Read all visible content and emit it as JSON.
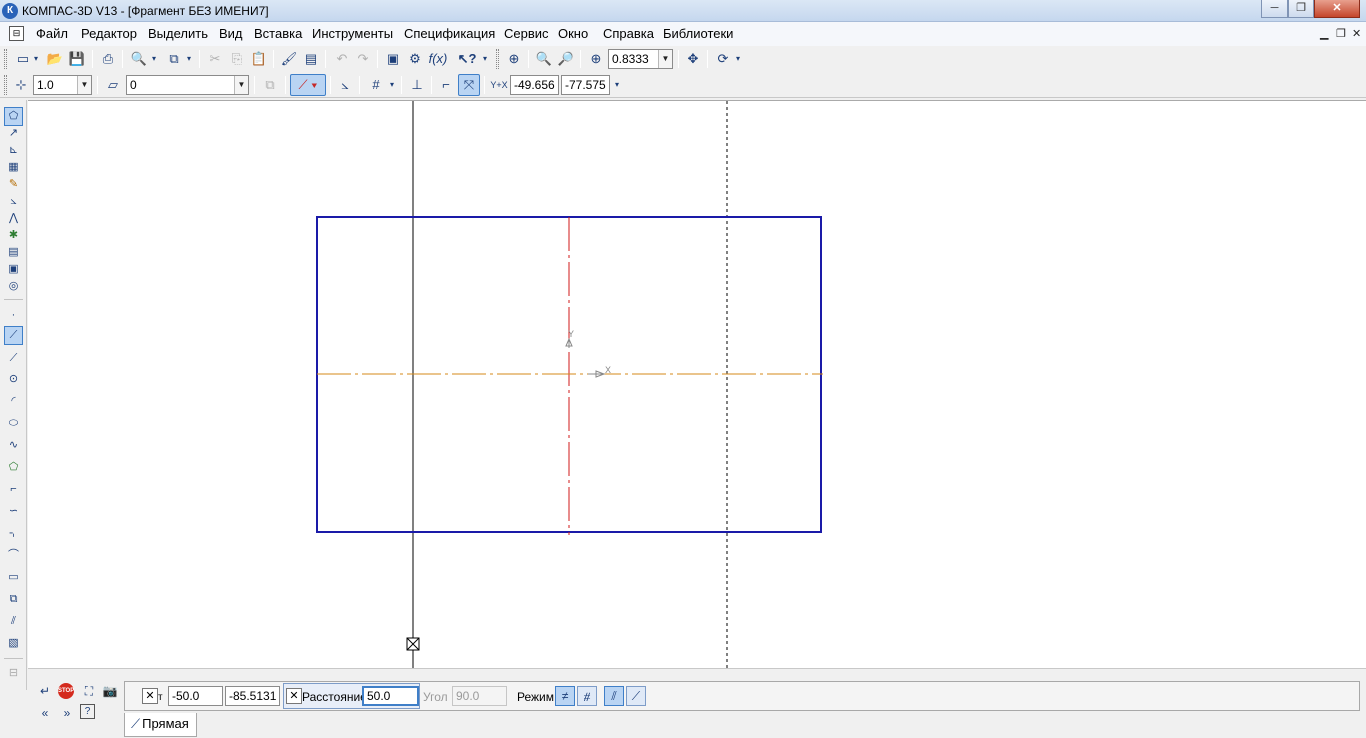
{
  "window": {
    "title": "КОМПАС-3D V13 - [Фрагмент БЕЗ ИМЕНИ7]",
    "logo_letter": "К",
    "minimize": "─",
    "maximize": "❐",
    "close": "✕"
  },
  "menu": {
    "items": [
      "Файл",
      "Редактор",
      "Выделить",
      "Вид",
      "Вставка",
      "Инструменты",
      "Спецификация",
      "Сервис",
      "Окно",
      "Справка",
      "Библиотеки"
    ],
    "mdi_minimize": "▁",
    "mdi_restore": "❐",
    "mdi_close": "✕"
  },
  "toolbar_standard": {
    "zoom_value": "0.8333",
    "func_label": "f(x)"
  },
  "toolbar_current_state": {
    "step_value": "1.0",
    "layer_value": "0",
    "cursor_x": "-49.656",
    "cursor_y": "-77.575",
    "coord_label": "Y+X"
  },
  "property_panel": {
    "point_x": "-50.0",
    "point_y": "-85.5131",
    "distance_label": "Расстояние",
    "distance_value": "50.0",
    "angle_label": "Угол",
    "angle_value": "90.0",
    "mode_label": "Режим",
    "tab_label": "Прямая",
    "point_label": "т",
    "stop_label": "STOP"
  },
  "canvas": {
    "axis_y_label": "Y",
    "axis_x_label": "X",
    "colors": {
      "rectangle": "#1a1aa8",
      "axial_red": "#d01818",
      "axial_orange": "#d48a1a",
      "aux_line": "#000000"
    }
  },
  "icons": {
    "left_panel": [
      "geometry-icon",
      "dimensions-icon",
      "symbols-icon",
      "edit-icon",
      "parametrization-icon",
      "measure-icon",
      "select-icon",
      "spec-icon",
      "reports-icon",
      "insert-icon",
      "fragment-lib-icon",
      "point-icon",
      "aux-line-icon",
      "segment-icon",
      "circle-icon",
      "arc-icon",
      "ellipse-icon",
      "spline-icon",
      "polyline-icon",
      "rectangle-icon",
      "curve-icon",
      "chamfer-icon",
      "fillet-icon",
      "frame-icon",
      "contour-icon",
      "hatch-icon",
      "fill-icon"
    ]
  }
}
